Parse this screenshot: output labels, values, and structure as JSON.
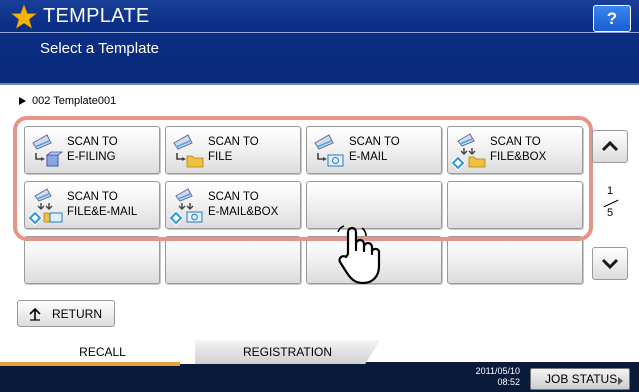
{
  "header": {
    "title": "TEMPLATE",
    "subtitle": "Select a Template",
    "help_label": "?",
    "star_icon": "star-icon"
  },
  "breadcrumb": {
    "text": "002 Template001"
  },
  "templates": [
    {
      "line1": "SCAN TO",
      "line2": "E-FILING",
      "icon": "scan-to-efiling-icon"
    },
    {
      "line1": "SCAN TO",
      "line2": "FILE",
      "icon": "scan-to-file-icon"
    },
    {
      "line1": "SCAN TO",
      "line2": "E-MAIL",
      "icon": "scan-to-email-icon"
    },
    {
      "line1": "SCAN TO",
      "line2": "FILE&BOX",
      "icon": "scan-to-filebox-icon"
    },
    {
      "line1": "SCAN TO",
      "line2": "FILE&E-MAIL",
      "icon": "scan-to-file-email-icon"
    },
    {
      "line1": "SCAN TO",
      "line2": "E-MAIL&BOX",
      "icon": "scan-to-email-box-icon"
    },
    {
      "line1": "",
      "line2": ""
    },
    {
      "line1": "",
      "line2": ""
    },
    {
      "line1": "",
      "line2": ""
    },
    {
      "line1": "",
      "line2": ""
    },
    {
      "line1": "",
      "line2": ""
    },
    {
      "line1": "",
      "line2": ""
    }
  ],
  "pagination": {
    "current": "1",
    "total": "5"
  },
  "return_label": "RETURN",
  "tabs": {
    "recall": "RECALL",
    "registration": "REGISTRATION"
  },
  "status": {
    "date": "2011/05/10",
    "time": "08:52",
    "job_status_label": "JOB STATUS"
  },
  "colors": {
    "header_bg": "#0a2a7a",
    "highlight": "#e69487",
    "tab_accent": "#e8a13a",
    "help_bg": "#1a5dd4"
  }
}
